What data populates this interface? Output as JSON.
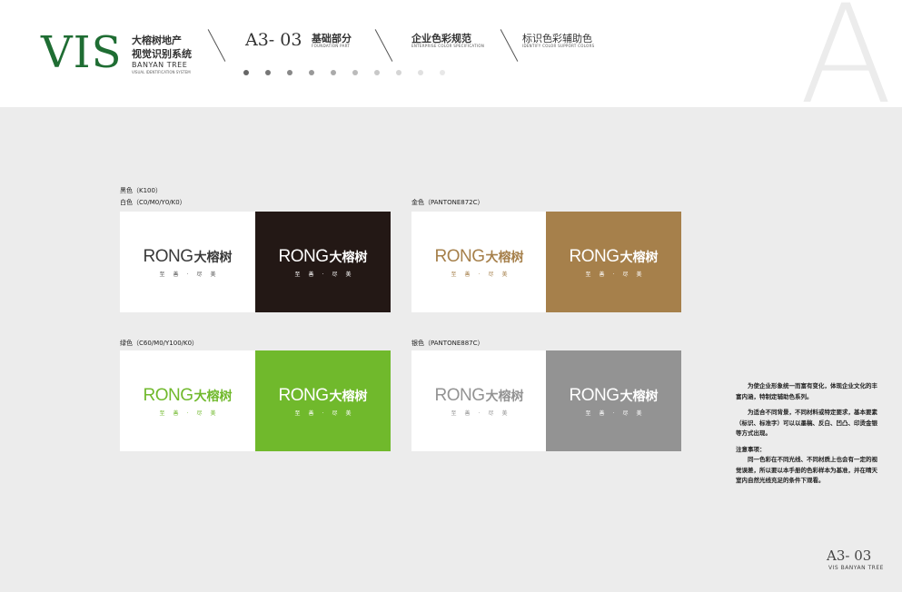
{
  "header": {
    "vis": "VIS",
    "brand_cn_1": "大榕树地产",
    "brand_cn_2": "视觉识别系统",
    "brand_en": "BANYAN TREE",
    "brand_en_sub": "VISUAL IDENTIFICATION SYSTEM",
    "code": "A3- 03",
    "section1_title": "基础部分",
    "section1_sub": "FOUNDATION PART",
    "section2_title": "企业色彩规范",
    "section2_sub": "ENTERPRISE COLOR SPECIFICATION",
    "section3_title": "标识色彩辅助色",
    "section3_sub": "IDENTIFY COLOR SUPPORT COLORS",
    "big_letter": "A",
    "dot_colors": [
      "#666666",
      "#777777",
      "#888888",
      "#999999",
      "#aaaaaa",
      "#bbbbbb",
      "#c8c8c8",
      "#d5d5d5",
      "#e0e0e0",
      "#e8e8e8"
    ]
  },
  "logo": {
    "rong": "RONG",
    "cn": "大榕树",
    "tagline": "至善·尽美"
  },
  "labels": {
    "black": "黑色（K100）",
    "white": "白色（C0/M0/Y0/K0）",
    "gold": "金色（PANTONE872C）",
    "green": "绿色（C60/M0/Y100/K0）",
    "silver": "银色（PANTONE887C）"
  },
  "colors": {
    "black": "#231815",
    "gold": "#a6804b",
    "green": "#70b92c",
    "silver": "#939393",
    "white": "#ffffff",
    "brand_green": "#1f6d33"
  },
  "notes": {
    "p1": "为使企业形象统一而富有变化，体现企业文化的丰富内涵，特制定辅助色系列。",
    "p2": "为适合不同背景，不同材料或特定要求，基本要素（标识、标准字）可以以墨稿、反白、凹凸、印烫金银等方式出现。",
    "head": "注意事项：",
    "p3": "同一色彩在不同光线、不同材质上也会有一定的视觉误差，所以要以本手册的色彩样本为基准，并在晴天室内自然光线充足的条件下观看。"
  },
  "footer": {
    "code": "A3- 03",
    "sub": "VIS BANYAN TREE"
  }
}
